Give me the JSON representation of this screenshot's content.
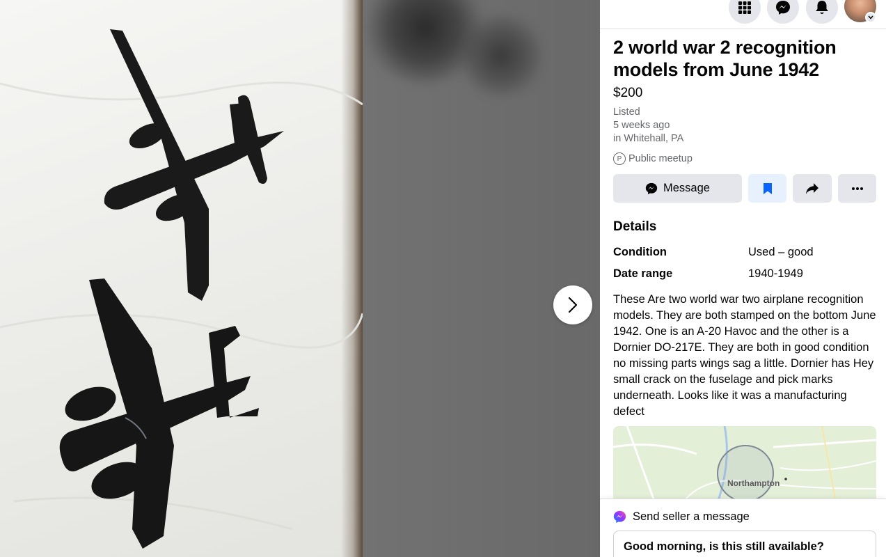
{
  "listing": {
    "title": "2 world war 2 recognition models from June 1942",
    "price": "$200",
    "listed_label": "Listed",
    "listed_time": "5 weeks ago",
    "location": "in Whitehall, PA",
    "meetup": "Public meetup",
    "meetup_icon_letter": "P"
  },
  "actions": {
    "message_label": "Message",
    "save_icon": "bookmark-icon",
    "share_icon": "share-icon",
    "more_icon": "more-dots-icon"
  },
  "details": {
    "heading": "Details",
    "rows": [
      {
        "key": "Condition",
        "value": "Used – good"
      },
      {
        "key": "Date range",
        "value": "1940-1949"
      }
    ],
    "description": "These Are two world war two airplane recognition models. They are both stamped on the bottom June 1942. One is an A-20 Havoc and the other is a Dornier DO-217E. They are both in good condition no missing parts wings sag a little. Dornier has Hey small crack on the fuselage and pick marks underneath. Looks like it was a manufacturing defect"
  },
  "map": {
    "place_label": "Northampton"
  },
  "send": {
    "title": "Send seller a message",
    "input_value": "Good morning, is this still available?"
  },
  "topbar": {
    "icons": [
      "menu-grid-icon",
      "messenger-icon",
      "notifications-bell-icon",
      "account-avatar"
    ]
  },
  "colors": {
    "button_gray": "#e4e6eb",
    "save_bg": "#e7f0fd",
    "accent_blue": "#0866ff",
    "text_secondary": "#65676b"
  }
}
